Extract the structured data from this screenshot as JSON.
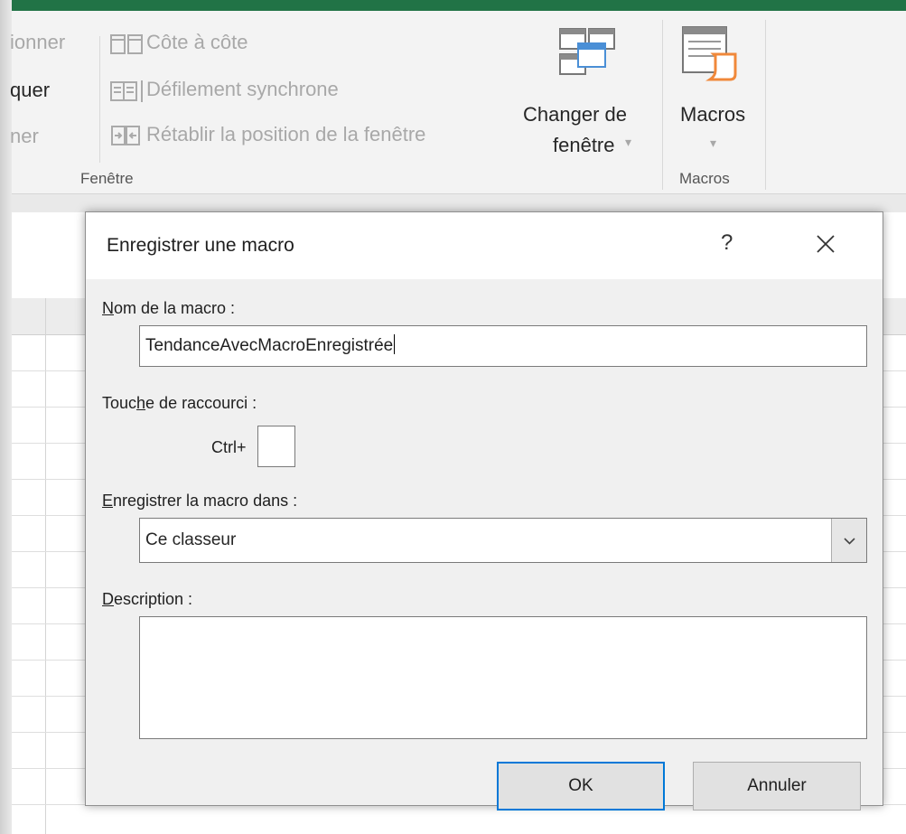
{
  "ribbon": {
    "left_truncated": [
      "ionner",
      "quer",
      "ner"
    ],
    "window_commands": {
      "side_by_side": "Côte à côte",
      "sync_scroll": "Défilement synchrone",
      "reset_position": "Rétablir la position de la fenêtre"
    },
    "switch_windows_line1": "Changer de",
    "switch_windows_line2": "fenêtre",
    "switch_windows_caret": "▾",
    "macros_button": "Macros",
    "macros_caret": "▾",
    "group_window_label": "Fenêtre",
    "group_macros_label": "Macros"
  },
  "dialog": {
    "title": "Enregistrer une macro",
    "help": "?",
    "macro_name_label_pre": "",
    "macro_name_label_mn": "N",
    "macro_name_label_post": "om de la macro :",
    "macro_name_value": "TendanceAvecMacroEnregistrée",
    "shortcut_label_pre": "Touc",
    "shortcut_label_mn": "h",
    "shortcut_label_post": "e de raccourci :",
    "ctrl_label": "Ctrl+",
    "shortcut_value": "",
    "store_label_pre": "",
    "store_label_mn": "E",
    "store_label_post": "nregistrer la macro dans :",
    "store_value": "Ce classeur",
    "description_label_pre": "",
    "description_label_mn": "D",
    "description_label_post": "escription :",
    "description_value": "",
    "ok_button": "OK",
    "cancel_button": "Annuler"
  },
  "colors": {
    "excel_green": "#217346",
    "focus_blue": "#0078d7",
    "macro_orange": "#f0883a",
    "window_blue": "#4a8fd6"
  },
  "icons": [
    "side-by-side-icon",
    "sync-scroll-icon",
    "reset-window-position-icon",
    "switch-windows-icon",
    "macros-icon",
    "close-icon",
    "chevron-down-icon"
  ]
}
